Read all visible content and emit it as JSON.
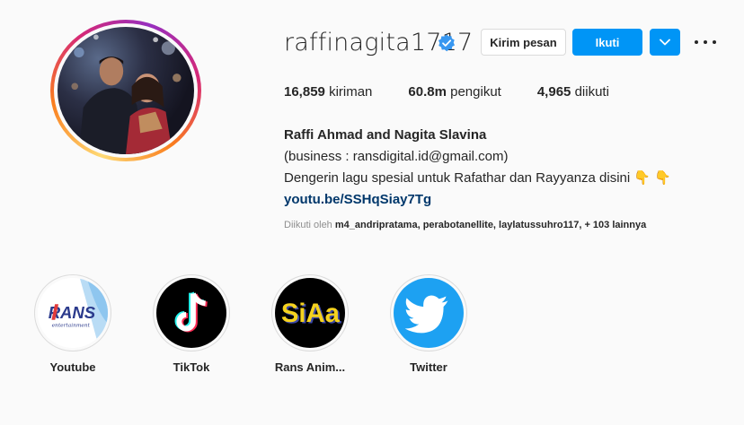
{
  "profile": {
    "username": "raffinagita1717",
    "verified": true,
    "actions": {
      "message_label": "Kirim pesan",
      "follow_label": "Ikuti"
    },
    "stats": {
      "posts_value": "16,859",
      "posts_label": "kiriman",
      "followers_value": "60.8m",
      "followers_label": "pengikut",
      "following_value": "4,965",
      "following_label": "diikuti"
    },
    "bio": {
      "full_name": "Raffi Ahmad and Nagita Slavina",
      "line1": "(business : ransdigital.id@gmail.com)",
      "line2": "Dengerin lagu spesial untuk Rafathar dan Rayyanza disini",
      "line2_emoji": "👇 👇",
      "link": "youtu.be/SSHqSiay7Tg"
    },
    "followed_by": {
      "prefix": "Diikuti oleh",
      "users": "m4_andripratama, perabotanellite, laylatussuhro117",
      "suffix": ", + 103 lainnya"
    }
  },
  "highlights": [
    {
      "label": "Youtube",
      "icon": "rans-entertainment-logo"
    },
    {
      "label": "TikTok",
      "icon": "tiktok-logo"
    },
    {
      "label": "Rans Anim...",
      "icon": "siaa-logo"
    },
    {
      "label": "Twitter",
      "icon": "twitter-bird-logo"
    }
  ],
  "colors": {
    "accent": "#0095f6",
    "verified": "#3897f0",
    "link": "#00376b",
    "muted": "#8e8e8e",
    "twitter": "#1da1f2"
  }
}
